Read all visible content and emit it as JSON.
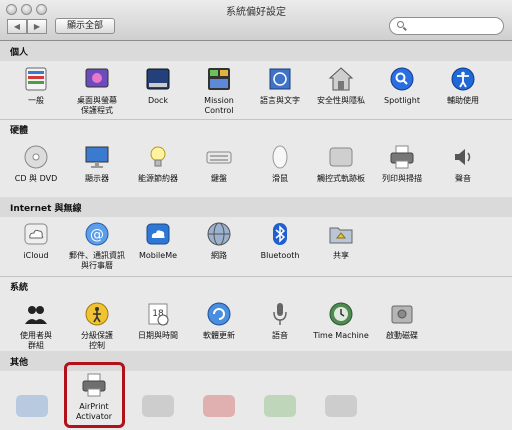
{
  "window": {
    "title": "系統偏好設定"
  },
  "toolbar": {
    "back": "◀",
    "forward": "▶",
    "show_all": "顯示全部"
  },
  "sections": [
    {
      "title": "個人",
      "items": [
        "一般",
        "桌面與螢幕\n保護程式",
        "Dock",
        "Mission\nControl",
        "語言與文字",
        "安全性與隱私",
        "Spotlight",
        "輔助使用"
      ]
    },
    {
      "title": "硬體",
      "items": [
        "CD 與 DVD",
        "顯示器",
        "能源節約器",
        "鍵盤",
        "滑鼠",
        "觸控式軌跡板",
        "列印與掃描",
        "聲音"
      ]
    },
    {
      "title": "Internet 與無線",
      "items": [
        "iCloud",
        "郵件、通訊資訊\n與行事曆",
        "MobileMe",
        "網路",
        "Bluetooth",
        "共享"
      ]
    },
    {
      "title": "系統",
      "items": [
        "使用者與\n群組",
        "分級保護\n控制",
        "日期與時間",
        "軟體更新",
        "語音",
        "Time Machine",
        "啟動磁碟"
      ]
    },
    {
      "title": "其他",
      "items": [
        "AirPrint\nActivator"
      ]
    }
  ],
  "icons": [
    "general-icon",
    "desktop-icon",
    "dock-icon",
    "mission-control-icon",
    "language-icon",
    "security-icon",
    "spotlight-icon",
    "accessibility-icon",
    "cd-dvd-icon",
    "display-icon",
    "energy-saver-icon",
    "keyboard-icon",
    "mouse-icon",
    "trackpad-icon",
    "printer-icon",
    "sound-icon",
    "icloud-icon",
    "mail-contacts-icon",
    "mobileme-icon",
    "network-icon",
    "bluetooth-icon",
    "sharing-icon",
    "users-groups-icon",
    "parental-controls-icon",
    "date-time-icon",
    "software-update-icon",
    "speech-icon",
    "time-machine-icon",
    "startup-disk-icon",
    "printer-icon"
  ],
  "colors": {
    "highlight": "#b2111a",
    "section_band": "#dadada",
    "window_bg": "#e9e9e9"
  }
}
